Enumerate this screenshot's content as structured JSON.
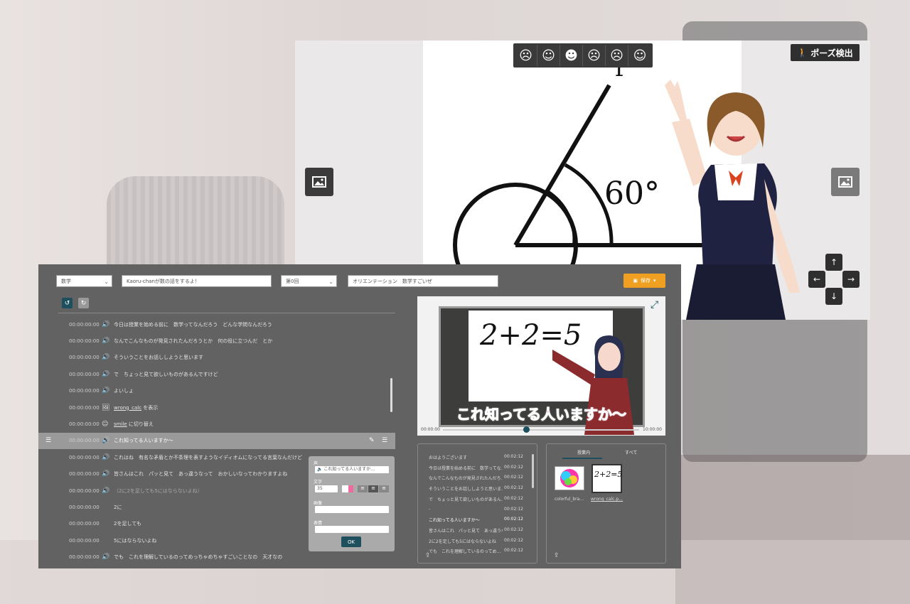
{
  "stage": {
    "pose_label": "ポーズ検出",
    "faces": [
      "neutral-face-icon",
      "smile-face-icon",
      "laugh-face-icon",
      "sad-face-icon",
      "angry-face-icon",
      "surprised-face-icon"
    ]
  },
  "editor": {
    "subject": "数学",
    "title": "Kaoru-chanが数の話をするよ！",
    "episode": "第0回",
    "episode_title": "オリエンテーション　数学すごいぜ",
    "save_label": "保存",
    "rows": [
      {
        "time": "00:00:00:00",
        "icon": "speaker",
        "text": "今日は授業を始める前に　数学ってなんだろう　どんな学問なんだろう"
      },
      {
        "time": "00:00:00:00",
        "icon": "speaker",
        "text": "なんでこんなものが発見されたんだろうとか　何の役に立つんだ　とか"
      },
      {
        "time": "00:00:00:00",
        "icon": "speaker",
        "text": "そういうことをお話ししようと思います"
      },
      {
        "time": "00:00:00:00",
        "icon": "speaker",
        "text": "で　ちょっと見て欲しいものがあるんですけど"
      },
      {
        "time": "00:00:00:00",
        "icon": "speaker",
        "text": "よいしょ"
      },
      {
        "time": "00:00:00:00",
        "icon": "image",
        "link": "wrong_calc",
        "text": " を表示"
      },
      {
        "time": "00:00:00:00",
        "icon": "face",
        "link": "smile",
        "text": " に切り替え"
      },
      {
        "time": "00:00:00:00",
        "icon": "speaker",
        "text": "これ知ってる人いますか〜"
      },
      {
        "time": "00:00:00:00",
        "icon": "speaker",
        "text": "これはね　有名な矛盾とか不条理を表すようなイディオムになってる言葉なんだけど"
      },
      {
        "time": "00:00:00:00",
        "icon": "speaker",
        "text": "皆さんはこれ　パッと見て　あっ違うなって　おかしいなってわかりますよね"
      },
      {
        "time": "00:00:00:00",
        "icon": "speaker",
        "text": "（2に2を足しても5にはならないよね）"
      },
      {
        "time": "00:00:00:00",
        "icon": "none",
        "text": "2に"
      },
      {
        "time": "00:00:00:00",
        "icon": "none",
        "text": "2を足しても"
      },
      {
        "time": "00:00:00:00",
        "icon": "none",
        "text": "5にはならないよね"
      },
      {
        "time": "00:00:00:00",
        "icon": "speaker",
        "text": "でも　これを理解しているのってめっちゃめちゃすごいことなの　天才なの"
      }
    ],
    "popup": {
      "voice_label": "声",
      "voice_value": "これ知ってる人いますか…",
      "text_label": "文字",
      "font_size": "35",
      "image_label": "画像",
      "expression_label": "表情",
      "ok_label": "OK"
    },
    "video": {
      "equation": "2+2=5",
      "caption": "これ知ってる人いますか〜",
      "time_start": "00:00:00",
      "time_end": "10:00:00"
    },
    "script_list": [
      {
        "text": "おはようございます",
        "time": "00:02:12"
      },
      {
        "text": "今日は授業を始める前に　数学ってな…",
        "time": "00:02:12"
      },
      {
        "text": "なんでこんなものが発見されたんだろ…",
        "time": "00:02:12"
      },
      {
        "text": "そういうことをお話ししようと思いま…",
        "time": "00:02:12"
      },
      {
        "text": "で　ちょっと見て欲しいものがあるん…",
        "time": "00:02:12"
      },
      {
        "text": "-",
        "time": "00:02:12"
      },
      {
        "text": "これ知ってる人いますか〜",
        "time": "00:02:12"
      },
      {
        "text": "皆さんはこれ　パッと見て　あっ違うな…",
        "time": "00:02:12"
      },
      {
        "text": "2に2を足しても5にはならないよね",
        "time": "00:02:12"
      },
      {
        "text": "でも　これを理解しているのってめ…",
        "time": "00:02:12"
      }
    ],
    "assets": {
      "tab_in_class": "授業内",
      "tab_all": "すべて",
      "items": [
        {
          "name": "colorful_bra…"
        },
        {
          "name": "wrong_calc.p…"
        }
      ]
    }
  }
}
